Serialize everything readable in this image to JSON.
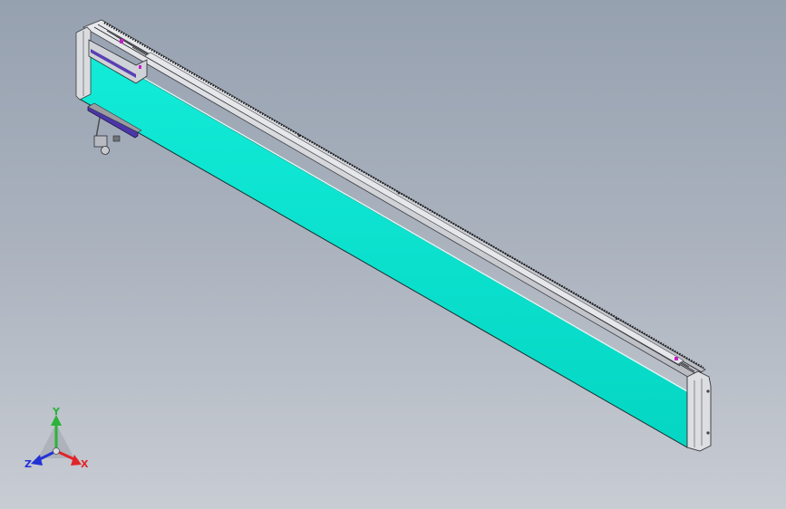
{
  "view": {
    "background_top": "#96a1b0",
    "background_bottom": "#c8ccd3"
  },
  "model": {
    "part": "linear-module-rail",
    "face_color": "#08e2cf",
    "profile_color": "#d4d6da",
    "accent_color": "#c81ec8",
    "bracket_color": "#4b36a8"
  },
  "triad": {
    "x_label": "X",
    "y_label": "Y",
    "z_label": "Z",
    "x_color": "#e0252a",
    "y_color": "#2bb33a",
    "z_color": "#2332d6"
  }
}
